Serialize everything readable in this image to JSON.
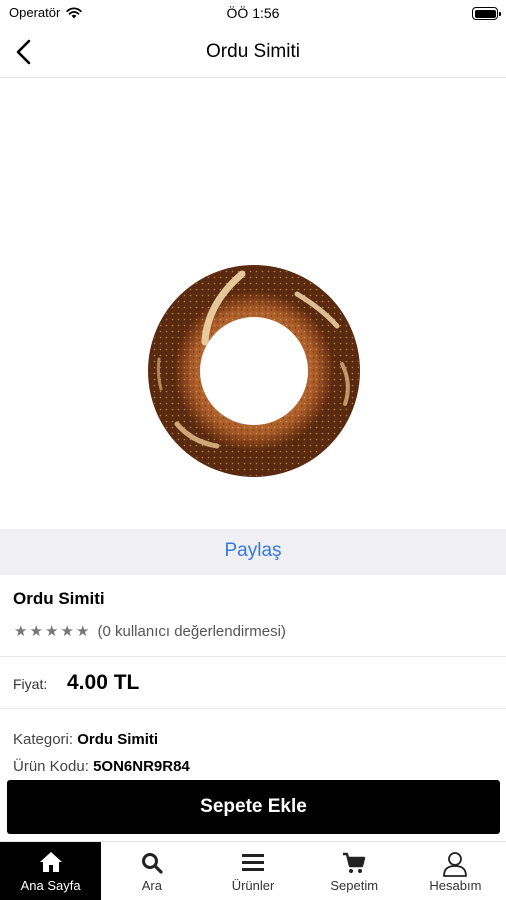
{
  "status_bar": {
    "carrier": "Operatör",
    "time": "ÖÖ 1:56"
  },
  "nav": {
    "title": "Ordu Simiti"
  },
  "share": {
    "label": "Paylaş"
  },
  "product": {
    "name": "Ordu Simiti",
    "rating_stars": 5,
    "rating_text": "(0 kullanıcı değerlendirmesi)",
    "price_label": "Fiyat:",
    "price_value": "4.00 TL",
    "category_label": "Kategori:",
    "category_value": "Ordu Simiti",
    "code_label": "Ürün Kodu:",
    "code_value": "5ON6NR9R84"
  },
  "cart": {
    "add_label": "Sepete Ekle"
  },
  "tabs": [
    {
      "label": "Ana Sayfa",
      "icon": "home-icon",
      "active": true
    },
    {
      "label": "Ara",
      "icon": "search-icon",
      "active": false
    },
    {
      "label": "Ürünler",
      "icon": "menu-icon",
      "active": false
    },
    {
      "label": "Sepetim",
      "icon": "cart-icon",
      "active": false
    },
    {
      "label": "Hesabım",
      "icon": "user-icon",
      "active": false
    }
  ],
  "colors": {
    "accent": "#2f7ae5",
    "share_bg": "#efeff4",
    "button_bg": "#000000"
  }
}
